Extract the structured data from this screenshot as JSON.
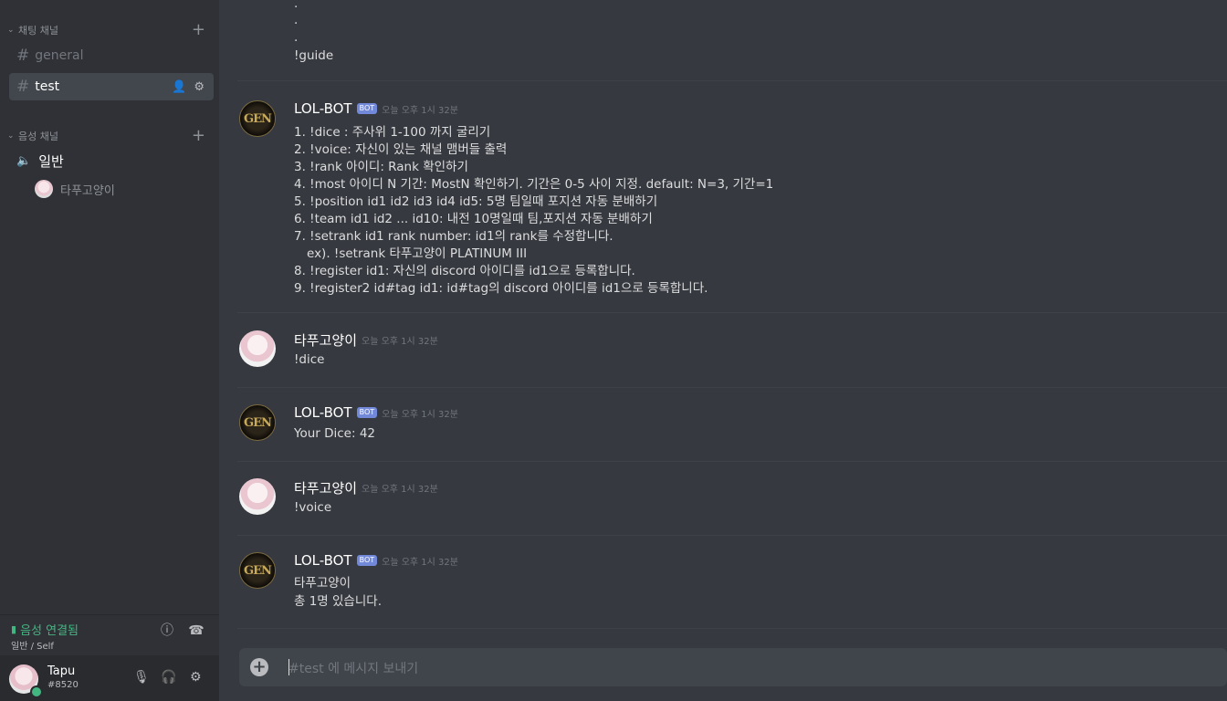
{
  "sidebar": {
    "text_category": {
      "label": "채팅 채널"
    },
    "channels": [
      {
        "name": "general"
      },
      {
        "name": "test"
      }
    ],
    "voice_category": {
      "label": "음성 채널"
    },
    "voice_channel": {
      "name": "일반",
      "user": "타푸고양이"
    },
    "voice_panel": {
      "status": "음성 연결됨",
      "sub": "일반 / Self"
    },
    "user": {
      "name": "Tapu",
      "tag": "#8520"
    }
  },
  "messages": {
    "tail": [
      ".",
      ".",
      ".",
      "!guide"
    ],
    "bot1": {
      "author": "LOL-BOT",
      "badge": "BOT",
      "time": "오늘 오후 1시 32분",
      "lines": [
        "1. !dice : 주사위 1-100 까지 굴리기",
        "2. !voice: 자신이 있는 채널 맴버들 출력",
        "3. !rank 아이디: Rank 확인하기",
        "4. !most 아이디 N 기간: MostN 확인하기. 기간은 0-5 사이 지정. default: N=3, 기간=1",
        "5. !position id1 id2 id3 id4 id5: 5명 팀일때 포지션 자동 분배하기",
        "6. !team id1 id2 ... id10: 내전 10명일때 팀,포지션 자동 분배하기",
        "7. !setrank id1 rank number: id1의 rank를 수정합니다.",
        "ex). !setrank 타푸고양이 PLATINUM III",
        "8. !register id1: 자신의 discord 아이디를 id1으로 등록합니다.",
        "9. !register2 id#tag id1: id#tag의 discord 아이디를 id1으로 등록합니다."
      ]
    },
    "user1": {
      "author": "타푸고양이",
      "time": "오늘 오후 1시 32분",
      "text": "!dice"
    },
    "bot2": {
      "author": "LOL-BOT",
      "badge": "BOT",
      "time": "오늘 오후 1시 32분",
      "text": "Your Dice: 42"
    },
    "user2": {
      "author": "타푸고양이",
      "time": "오늘 오후 1시 32분",
      "text": "!voice"
    },
    "bot3": {
      "author": "LOL-BOT",
      "badge": "BOT",
      "time": "오늘 오후 1시 32분",
      "lines": [
        "타푸고양이",
        "총 1명 있습니다."
      ]
    }
  },
  "composer": {
    "placeholder": "#test 에 메시지 보내기"
  }
}
